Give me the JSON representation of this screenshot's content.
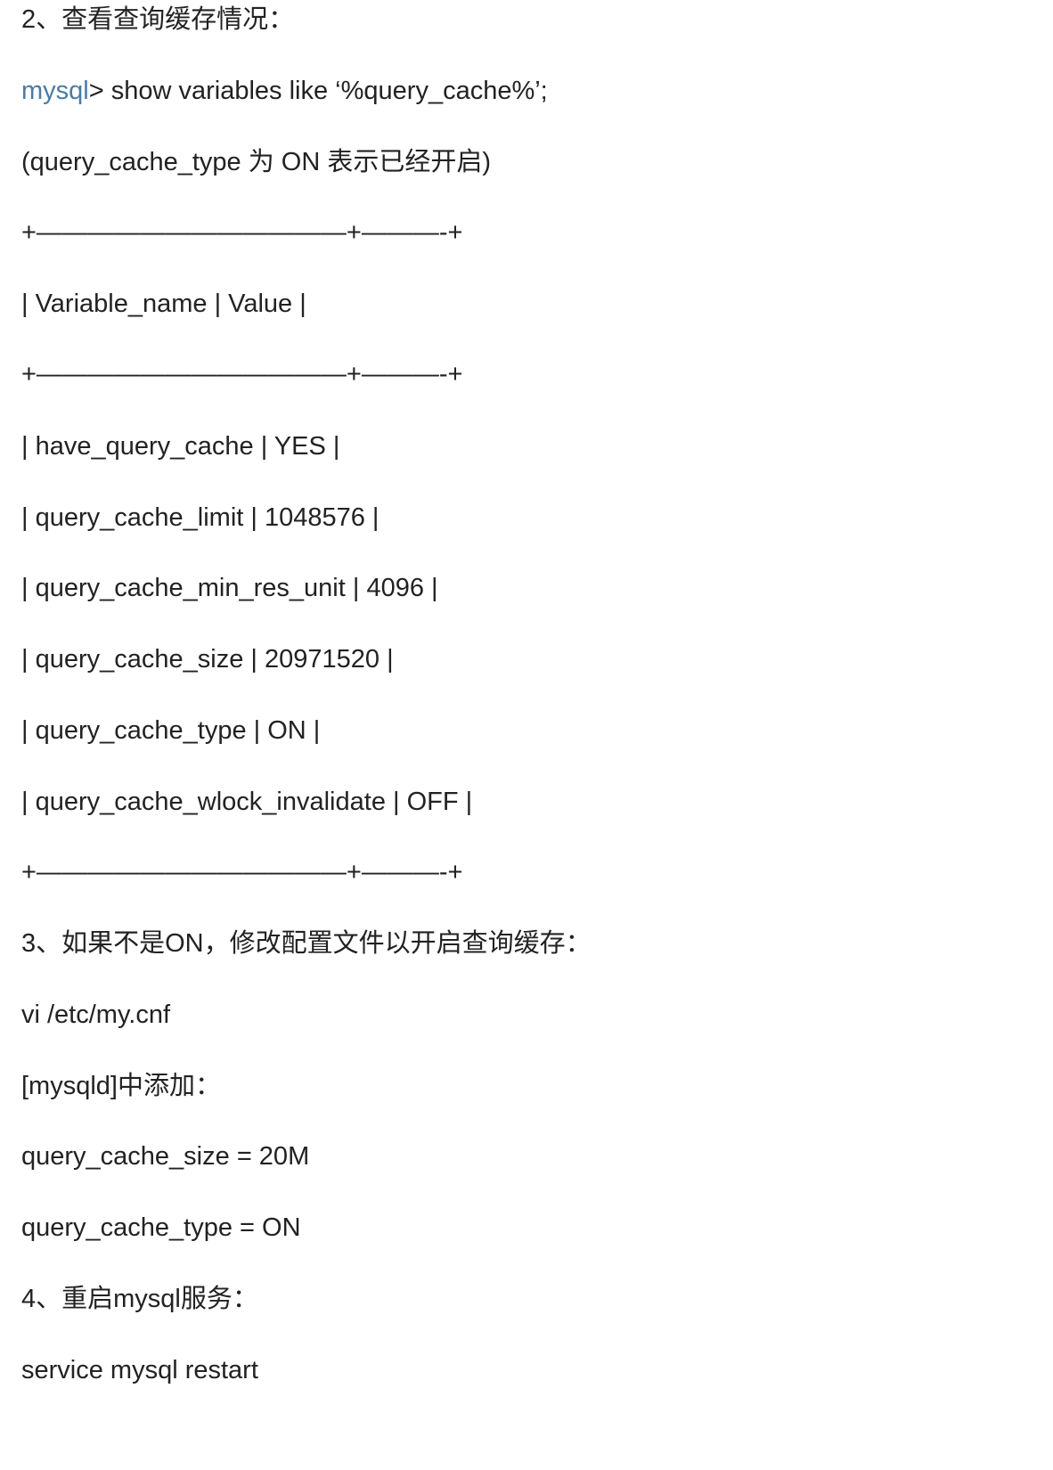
{
  "colors": {
    "text": "#222222",
    "link": "#4a7ba6",
    "background": "#ffffff"
  },
  "lines": {
    "step2": "2、查看查询缓存情况：",
    "cmd_link": "mysql",
    "cmd_rest": "> show variables like ‘%query_cache%’;",
    "note": "(query_cache_type 为 ON 表示已经开启)",
    "border1": "+————————————+———-+",
    "header": "| Variable_name | Value |",
    "border2": "+————————————+———-+",
    "row1": "| have_query_cache | YES |",
    "row2": "| query_cache_limit | 1048576 |",
    "row3": "| query_cache_min_res_unit | 4096 |",
    "row4": "| query_cache_size | 20971520 |",
    "row5": "| query_cache_type | ON |",
    "row6": "| query_cache_wlock_invalidate | OFF |",
    "border3": "+————————————+———-+",
    "step3": "3、如果不是ON，修改配置文件以开启查询缓存：",
    "vi": "vi /etc/my.cnf",
    "mysqld_add": "[mysqld]中添加：",
    "cfg_size": "query_cache_size = 20M",
    "cfg_type": "query_cache_type = ON",
    "step4": "4、重启mysql服务：",
    "restart": "service mysql restart"
  }
}
